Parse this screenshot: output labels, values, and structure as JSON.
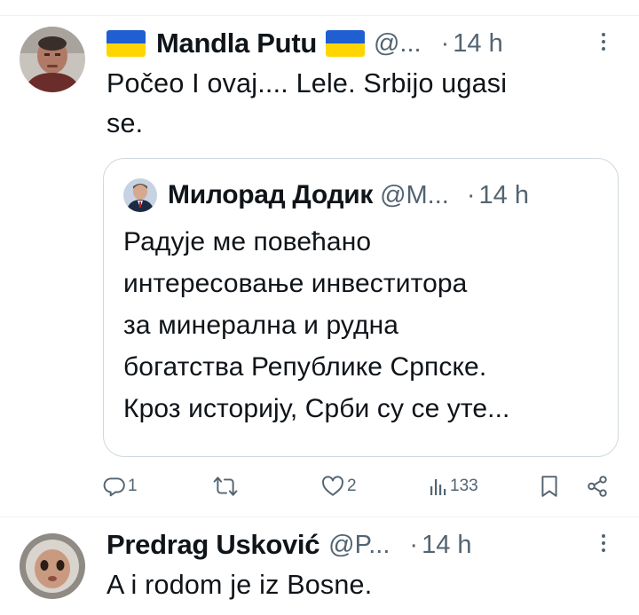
{
  "tweets": [
    {
      "author_name": "Mandla Putu",
      "handle": "@...",
      "separator": "·",
      "time": "14 h",
      "text_lines": [
        "Počeo I ovaj.... Lele. Srbijo ugasi",
        "se."
      ],
      "avatar_icon": "man-portrait-avatar",
      "flag_icon": "ukraine-flag-icon",
      "flag_colors": [
        "#1f5fd1",
        "#ffd500"
      ],
      "quoted": {
        "author_name": "Милорад Додик",
        "handle": "@M...",
        "separator": "·",
        "time": "14 h",
        "avatar_icon": "man-in-suit-avatar",
        "text_lines": [
          "Радује ме повећано",
          "интересовање инвеститора",
          "за минерална и рудна",
          "богатства Републике Српске.",
          "Кроз историју, Срби су се уте..."
        ]
      },
      "actions": {
        "replies": "1",
        "reposts": "",
        "likes": "2",
        "views": "133"
      }
    },
    {
      "author_name": "Predrag Usković",
      "handle": "@P...",
      "separator": "·",
      "time": "14 h",
      "text_lines": [
        "A i rodom je iz Bosne."
      ],
      "avatar_icon": "child-face-avatar"
    }
  ],
  "colors": {
    "text": "#0f1419",
    "secondary": "#536471",
    "border": "#cfd9de",
    "divider": "#eff3f4"
  }
}
